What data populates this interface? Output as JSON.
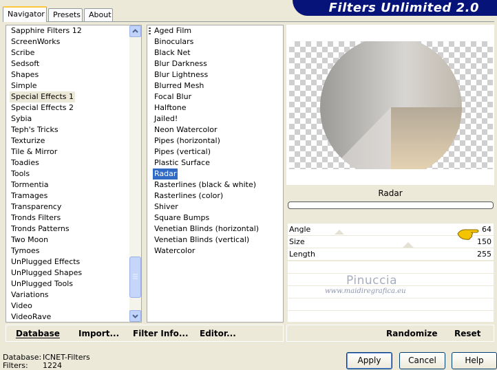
{
  "app_title": "Filters Unlimited 2.0",
  "tabs": [
    "Navigator",
    "Presets",
    "About"
  ],
  "categories": [
    "Sapphire Filters 12",
    "ScreenWorks",
    "Scribe",
    "Sedsoft",
    "Shapes",
    "Simple",
    "Special Effects 1",
    "Special Effects 2",
    "Sybia",
    "Teph's Tricks",
    "Texturize",
    "Tile & Mirror",
    "Toadies",
    "Tools",
    "Tormentia",
    "Tramages",
    "Transparency",
    "Tronds Filters",
    "Tronds Patterns",
    "Two Moon",
    "Tymoes",
    "UnPlugged Effects",
    "UnPlugged Shapes",
    "UnPlugged Tools",
    "Variations",
    "Video",
    "VideoRave"
  ],
  "selected_category": "Special Effects 1",
  "filters": [
    "Aged Film",
    "Binoculars",
    "Black Net",
    "Blur Darkness",
    "Blur Lightness",
    "Blurred Mesh",
    "Focal Blur",
    "Halftone",
    "Jailed!",
    "Neon Watercolor",
    "Pipes (horizontal)",
    "Pipes (vertical)",
    "Plastic Surface",
    "Radar",
    "Rasterlines (black & white)",
    "Rasterlines (color)",
    "Shiver",
    "Square Bumps",
    "Venetian Blinds (horizontal)",
    "Venetian Blinds (vertical)",
    "Watercolor"
  ],
  "selected_filter": "Radar",
  "preview_filter_name": "Radar",
  "params": [
    {
      "label": "Angle",
      "value": "64"
    },
    {
      "label": "Size",
      "value": "150"
    },
    {
      "label": "Length",
      "value": "255"
    }
  ],
  "watermark": {
    "name": "Pinuccia",
    "site": "www.maidiregrafica.eu"
  },
  "bottom_links": {
    "database": "Database",
    "import": "Import...",
    "filter_info": "Filter Info...",
    "editor": "Editor...",
    "randomize": "Randomize",
    "reset": "Reset"
  },
  "status": {
    "database_label": "Database:",
    "database_value": "ICNET-Filters",
    "filters_label": "Filters:",
    "filters_value": "1224"
  },
  "buttons": {
    "apply": "Apply",
    "cancel": "Cancel",
    "help": "Help"
  }
}
